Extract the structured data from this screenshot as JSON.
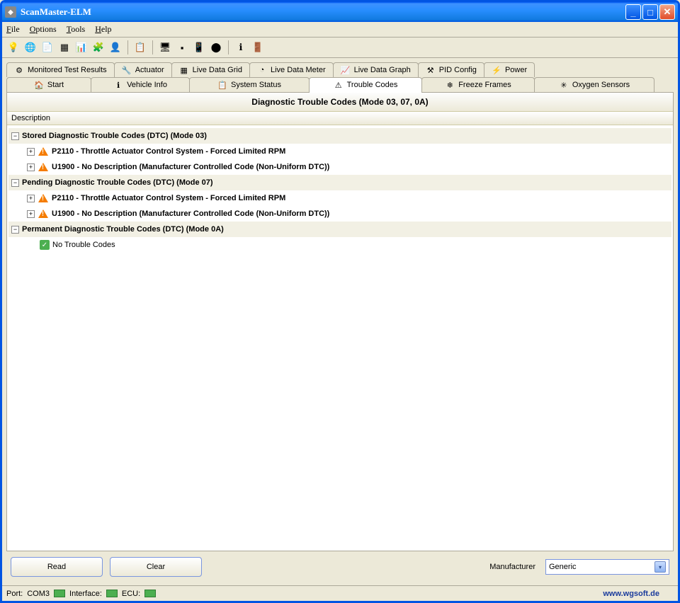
{
  "window": {
    "title": "ScanMaster-ELM"
  },
  "menu": {
    "file": "File",
    "options": "Options",
    "tools": "Tools",
    "help": "Help"
  },
  "tabs_row1": [
    {
      "label": "Monitored Test Results",
      "icon": "⚙"
    },
    {
      "label": "Actuator",
      "icon": "🔧"
    },
    {
      "label": "Live Data Grid",
      "icon": "▦"
    },
    {
      "label": "Live Data Meter",
      "icon": "◔"
    },
    {
      "label": "Live Data Graph",
      "icon": "📈"
    },
    {
      "label": "PID Config",
      "icon": "⚒"
    },
    {
      "label": "Power",
      "icon": "⚡"
    }
  ],
  "tabs_row2": [
    {
      "label": "Start",
      "icon": "🏠"
    },
    {
      "label": "Vehicle Info",
      "icon": "ℹ"
    },
    {
      "label": "System Status",
      "icon": "📋"
    },
    {
      "label": "Trouble Codes",
      "icon": "⚠",
      "active": true
    },
    {
      "label": "Freeze Frames",
      "icon": "❄"
    },
    {
      "label": "Oxygen Sensors",
      "icon": "✳"
    }
  ],
  "panel": {
    "title": "Diagnostic Trouble Codes (Mode 03, 07, 0A)",
    "column": "Description"
  },
  "tree": {
    "stored": {
      "label": "Stored Diagnostic Trouble Codes (DTC) (Mode 03)",
      "items": [
        "P2110 - Throttle Actuator Control System - Forced Limited RPM",
        "U1900 - No Description (Manufacturer Controlled Code (Non-Uniform DTC))"
      ]
    },
    "pending": {
      "label": "Pending Diagnostic Trouble Codes (DTC) (Mode 07)",
      "items": [
        "P2110 - Throttle Actuator Control System - Forced Limited RPM",
        "U1900 - No Description (Manufacturer Controlled Code (Non-Uniform DTC))"
      ]
    },
    "permanent": {
      "label": "Permanent Diagnostic Trouble Codes (DTC) (Mode 0A)",
      "empty": "No Trouble Codes"
    }
  },
  "buttons": {
    "read": "Read",
    "clear": "Clear"
  },
  "manufacturer": {
    "label": "Manufacturer",
    "value": "Generic"
  },
  "status": {
    "port_label": "Port:",
    "port": "COM3",
    "iface_label": "Interface:",
    "ecu_label": "ECU:",
    "url": "www.wgsoft.de"
  }
}
